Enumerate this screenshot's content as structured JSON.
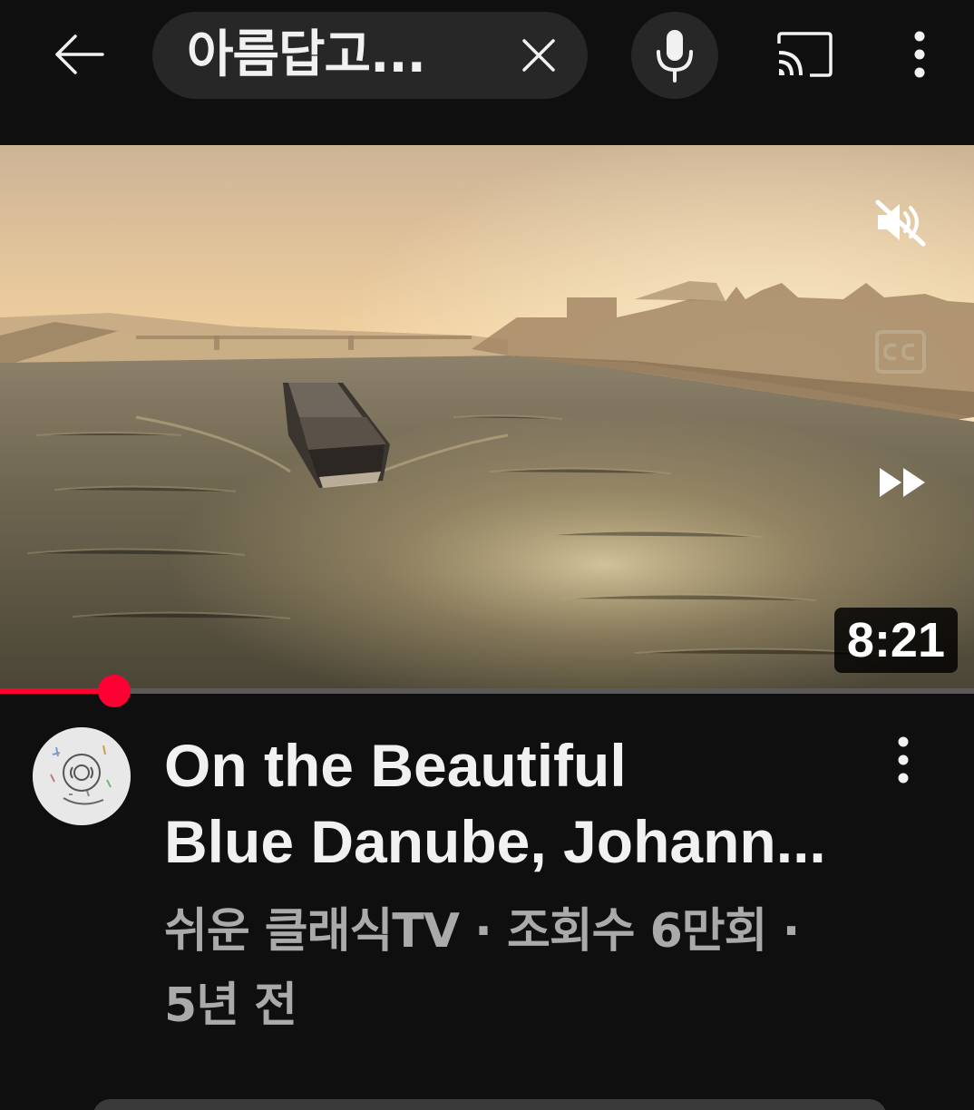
{
  "topbar": {
    "back_icon": "arrow-left-icon",
    "search_query": "아름답고...",
    "clear_icon": "close-icon",
    "mic_icon": "microphone-icon",
    "cast_icon": "cast-icon",
    "more_icon": "more-vertical-icon"
  },
  "video": {
    "duration": "8:21",
    "mute_icon": "volume-off-icon",
    "captions_icon": "closed-captions-icon",
    "fast_forward_icon": "fast-forward-icon",
    "progress_fraction": 0.117,
    "progress_color": "#ff0033"
  },
  "item": {
    "title_line1": "On the Beautiful",
    "title_line2": "Blue Danube, Johann...",
    "meta_line1": "쉬운 클래식TV · 조회수 6만회 ·",
    "meta_line2": "5년 전",
    "more_icon": "more-vertical-icon",
    "avatar_icon": "channel-avatar"
  },
  "colors": {
    "background": "#0f0f0f",
    "pill": "#272727",
    "text_primary": "#f1f1f1",
    "text_secondary": "#aaaaaa"
  }
}
